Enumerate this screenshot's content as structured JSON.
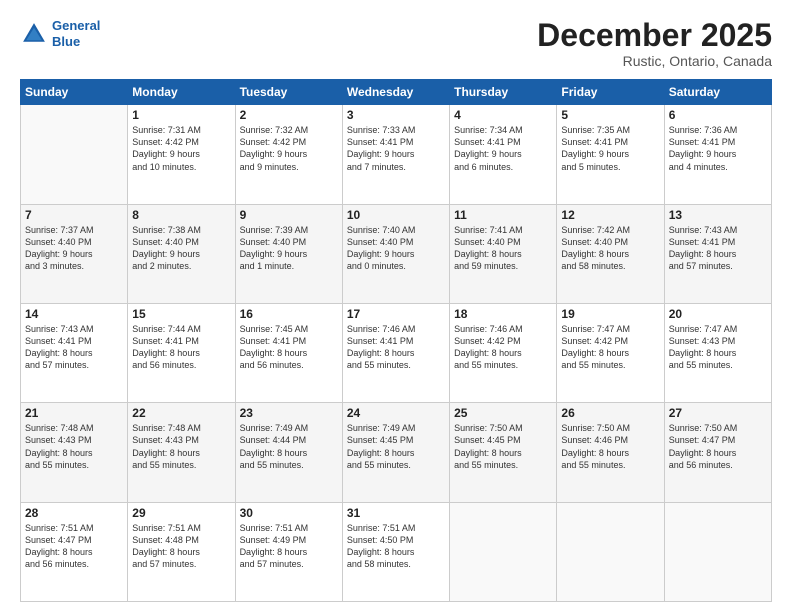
{
  "logo": {
    "line1": "General",
    "line2": "Blue"
  },
  "title": "December 2025",
  "subtitle": "Rustic, Ontario, Canada",
  "headers": [
    "Sunday",
    "Monday",
    "Tuesday",
    "Wednesday",
    "Thursday",
    "Friday",
    "Saturday"
  ],
  "weeks": [
    [
      {
        "day": "",
        "info": ""
      },
      {
        "day": "1",
        "info": "Sunrise: 7:31 AM\nSunset: 4:42 PM\nDaylight: 9 hours\nand 10 minutes."
      },
      {
        "day": "2",
        "info": "Sunrise: 7:32 AM\nSunset: 4:42 PM\nDaylight: 9 hours\nand 9 minutes."
      },
      {
        "day": "3",
        "info": "Sunrise: 7:33 AM\nSunset: 4:41 PM\nDaylight: 9 hours\nand 7 minutes."
      },
      {
        "day": "4",
        "info": "Sunrise: 7:34 AM\nSunset: 4:41 PM\nDaylight: 9 hours\nand 6 minutes."
      },
      {
        "day": "5",
        "info": "Sunrise: 7:35 AM\nSunset: 4:41 PM\nDaylight: 9 hours\nand 5 minutes."
      },
      {
        "day": "6",
        "info": "Sunrise: 7:36 AM\nSunset: 4:41 PM\nDaylight: 9 hours\nand 4 minutes."
      }
    ],
    [
      {
        "day": "7",
        "info": "Sunrise: 7:37 AM\nSunset: 4:40 PM\nDaylight: 9 hours\nand 3 minutes."
      },
      {
        "day": "8",
        "info": "Sunrise: 7:38 AM\nSunset: 4:40 PM\nDaylight: 9 hours\nand 2 minutes."
      },
      {
        "day": "9",
        "info": "Sunrise: 7:39 AM\nSunset: 4:40 PM\nDaylight: 9 hours\nand 1 minute."
      },
      {
        "day": "10",
        "info": "Sunrise: 7:40 AM\nSunset: 4:40 PM\nDaylight: 9 hours\nand 0 minutes."
      },
      {
        "day": "11",
        "info": "Sunrise: 7:41 AM\nSunset: 4:40 PM\nDaylight: 8 hours\nand 59 minutes."
      },
      {
        "day": "12",
        "info": "Sunrise: 7:42 AM\nSunset: 4:40 PM\nDaylight: 8 hours\nand 58 minutes."
      },
      {
        "day": "13",
        "info": "Sunrise: 7:43 AM\nSunset: 4:41 PM\nDaylight: 8 hours\nand 57 minutes."
      }
    ],
    [
      {
        "day": "14",
        "info": "Sunrise: 7:43 AM\nSunset: 4:41 PM\nDaylight: 8 hours\nand 57 minutes."
      },
      {
        "day": "15",
        "info": "Sunrise: 7:44 AM\nSunset: 4:41 PM\nDaylight: 8 hours\nand 56 minutes."
      },
      {
        "day": "16",
        "info": "Sunrise: 7:45 AM\nSunset: 4:41 PM\nDaylight: 8 hours\nand 56 minutes."
      },
      {
        "day": "17",
        "info": "Sunrise: 7:46 AM\nSunset: 4:41 PM\nDaylight: 8 hours\nand 55 minutes."
      },
      {
        "day": "18",
        "info": "Sunrise: 7:46 AM\nSunset: 4:42 PM\nDaylight: 8 hours\nand 55 minutes."
      },
      {
        "day": "19",
        "info": "Sunrise: 7:47 AM\nSunset: 4:42 PM\nDaylight: 8 hours\nand 55 minutes."
      },
      {
        "day": "20",
        "info": "Sunrise: 7:47 AM\nSunset: 4:43 PM\nDaylight: 8 hours\nand 55 minutes."
      }
    ],
    [
      {
        "day": "21",
        "info": "Sunrise: 7:48 AM\nSunset: 4:43 PM\nDaylight: 8 hours\nand 55 minutes."
      },
      {
        "day": "22",
        "info": "Sunrise: 7:48 AM\nSunset: 4:43 PM\nDaylight: 8 hours\nand 55 minutes."
      },
      {
        "day": "23",
        "info": "Sunrise: 7:49 AM\nSunset: 4:44 PM\nDaylight: 8 hours\nand 55 minutes."
      },
      {
        "day": "24",
        "info": "Sunrise: 7:49 AM\nSunset: 4:45 PM\nDaylight: 8 hours\nand 55 minutes."
      },
      {
        "day": "25",
        "info": "Sunrise: 7:50 AM\nSunset: 4:45 PM\nDaylight: 8 hours\nand 55 minutes."
      },
      {
        "day": "26",
        "info": "Sunrise: 7:50 AM\nSunset: 4:46 PM\nDaylight: 8 hours\nand 55 minutes."
      },
      {
        "day": "27",
        "info": "Sunrise: 7:50 AM\nSunset: 4:47 PM\nDaylight: 8 hours\nand 56 minutes."
      }
    ],
    [
      {
        "day": "28",
        "info": "Sunrise: 7:51 AM\nSunset: 4:47 PM\nDaylight: 8 hours\nand 56 minutes."
      },
      {
        "day": "29",
        "info": "Sunrise: 7:51 AM\nSunset: 4:48 PM\nDaylight: 8 hours\nand 57 minutes."
      },
      {
        "day": "30",
        "info": "Sunrise: 7:51 AM\nSunset: 4:49 PM\nDaylight: 8 hours\nand 57 minutes."
      },
      {
        "day": "31",
        "info": "Sunrise: 7:51 AM\nSunset: 4:50 PM\nDaylight: 8 hours\nand 58 minutes."
      },
      {
        "day": "",
        "info": ""
      },
      {
        "day": "",
        "info": ""
      },
      {
        "day": "",
        "info": ""
      }
    ]
  ]
}
